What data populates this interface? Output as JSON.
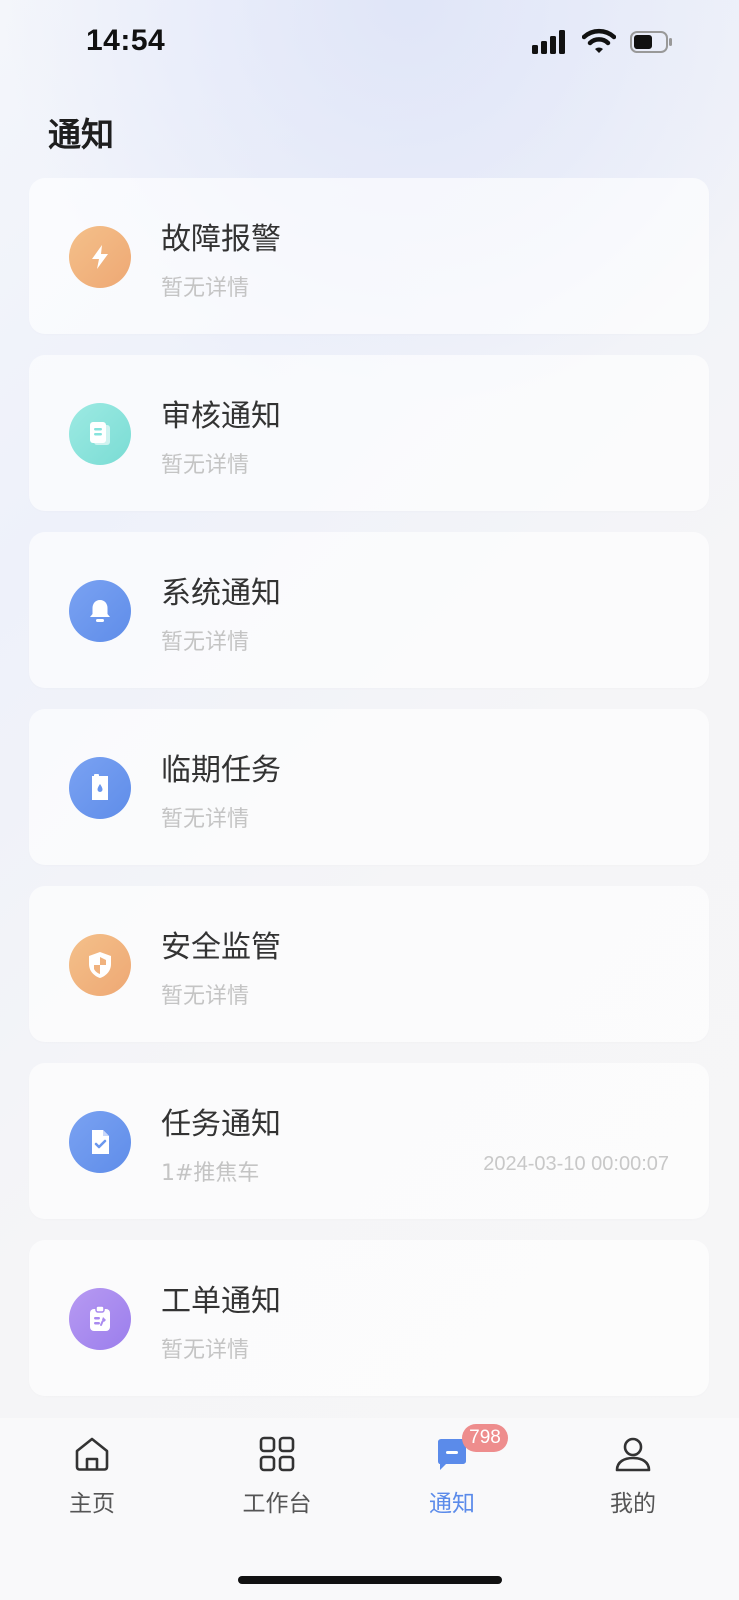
{
  "status_bar": {
    "time": "14:54",
    "icons": [
      "signal-icon",
      "wifi-icon",
      "battery-icon"
    ]
  },
  "header": {
    "title": "通知"
  },
  "notices": [
    {
      "title": "故障报警",
      "subtitle": "暂无详情",
      "time": "",
      "icon": "lightning-icon",
      "color": "#f0b27e"
    },
    {
      "title": "审核通知",
      "subtitle": "暂无详情",
      "time": "",
      "icon": "document-icon",
      "color": "#86e3dc"
    },
    {
      "title": "系统通知",
      "subtitle": "暂无详情",
      "time": "",
      "icon": "bell-icon",
      "color": "#6b97ee"
    },
    {
      "title": "临期任务",
      "subtitle": "暂无详情",
      "time": "",
      "icon": "hourglass-icon",
      "color": "#6b97ee"
    },
    {
      "title": "安全监管",
      "subtitle": "暂无详情",
      "time": "",
      "icon": "shield-icon",
      "color": "#f0b27e"
    },
    {
      "title": "任务通知",
      "subtitle": "1#推焦车",
      "time": "2024-03-10 00:00:07",
      "icon": "task-check-icon",
      "color": "#6b97ee"
    },
    {
      "title": "工单通知",
      "subtitle": "暂无详情",
      "time": "",
      "icon": "work-order-icon",
      "color": "#a98aef"
    }
  ],
  "tab_bar": {
    "items": [
      {
        "label": "主页",
        "icon": "home-icon"
      },
      {
        "label": "工作台",
        "icon": "grid-icon"
      },
      {
        "label": "通知",
        "icon": "message-icon",
        "badge": "798",
        "active": true
      },
      {
        "label": "我的",
        "icon": "user-icon"
      }
    ]
  },
  "colors": {
    "accent": "#5b8bea",
    "badge": "#ee8d8d"
  }
}
